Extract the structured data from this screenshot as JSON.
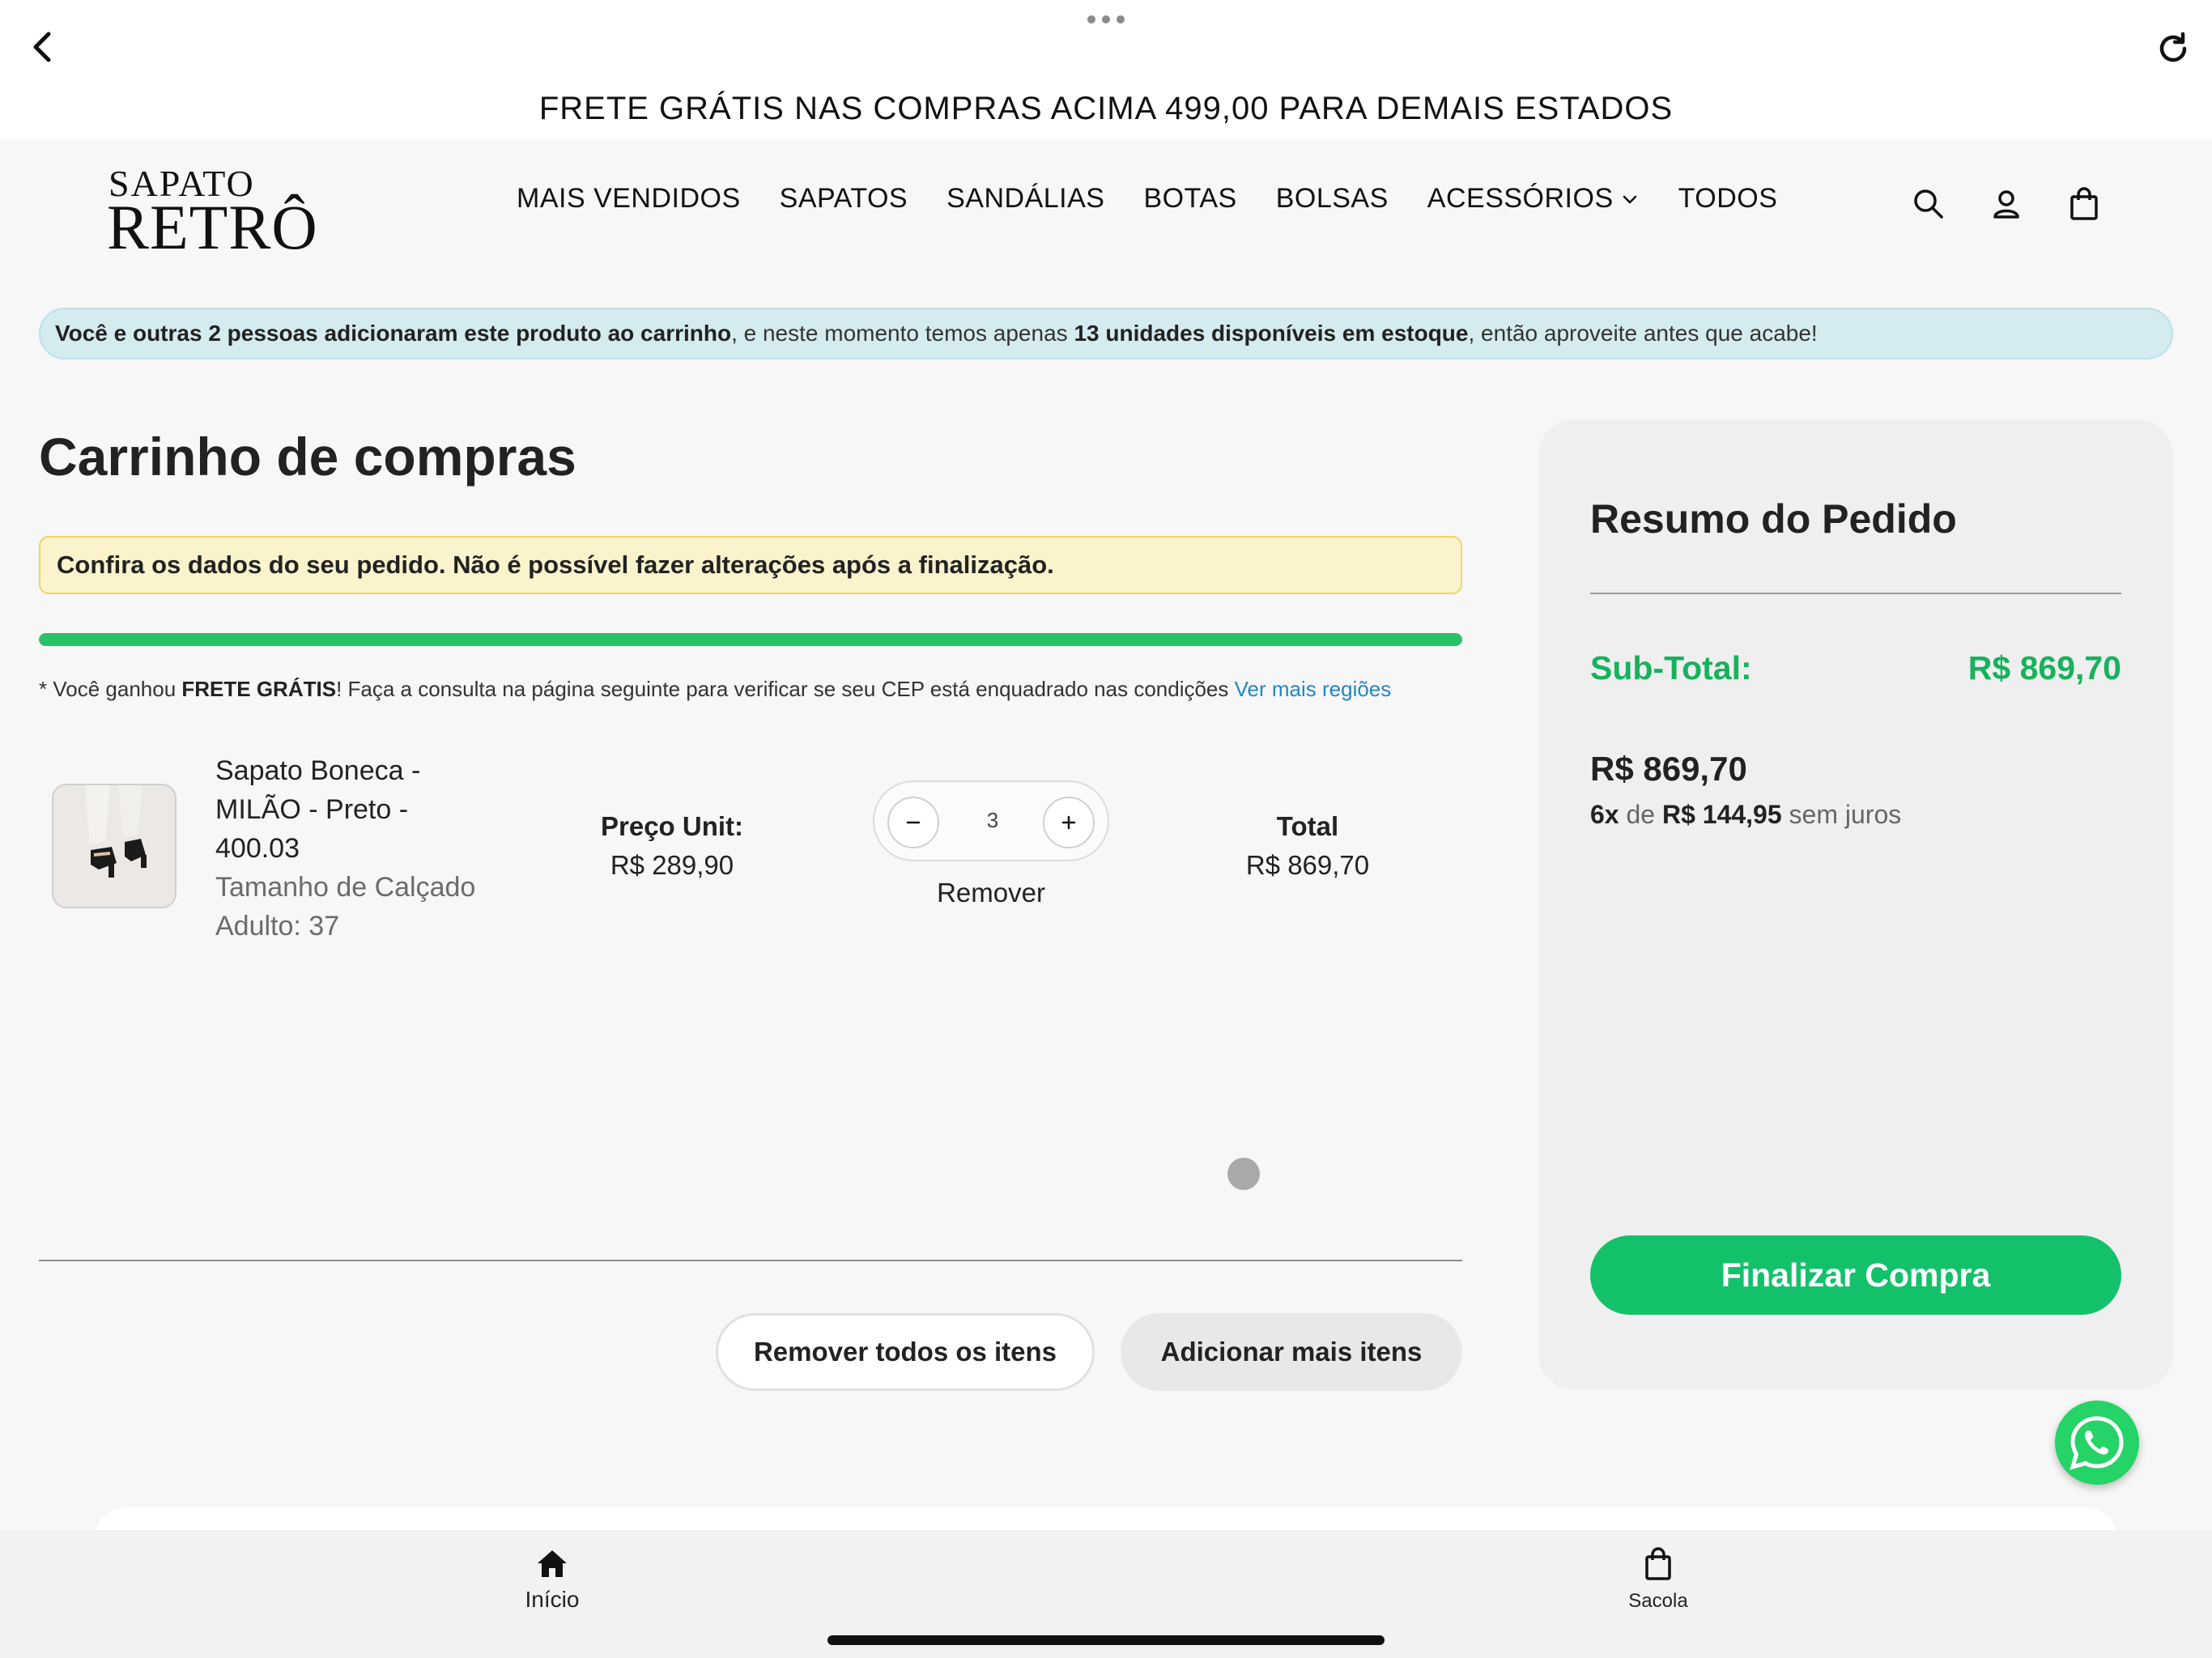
{
  "browser": {
    "back_icon": "chevron-left-icon",
    "reload_icon": "reload-icon",
    "more_icon": "ellipsis-icon"
  },
  "promo": {
    "text": "FRETE GRÁTIS NAS COMPRAS ACIMA 499,00 PARA DEMAIS ESTADOS"
  },
  "header": {
    "logo_line1": "SAPATO",
    "logo_line2": "RETRÔ",
    "nav": [
      {
        "label": "MAIS VENDIDOS"
      },
      {
        "label": "SAPATOS"
      },
      {
        "label": "SANDÁLIAS"
      },
      {
        "label": "BOTAS"
      },
      {
        "label": "BOLSAS"
      },
      {
        "label": "ACESSÓRIOS"
      },
      {
        "label": "TODOS"
      }
    ],
    "icons": [
      "search-icon",
      "user-icon",
      "shopping-bag-icon"
    ]
  },
  "proof_banner": {
    "bold1": "Você e outras 2 pessoas adicionaram este produto ao carrinho",
    "text1": ", e neste momento temos apenas ",
    "bold2": "13 unidades disponíveis em estoque",
    "text2": ", então aproveite antes que acabe!"
  },
  "cart": {
    "title": "Carrinho de compras",
    "warning": "Confira os dados do seu pedido. Não é possível fazer alterações após a finalização.",
    "progress_fraction": 1.0,
    "free_ship": {
      "prefix": "* Você ganhou ",
      "bold": "FRETE GRÁTIS",
      "suffix": "! Faça a consulta na página seguinte para verificar se seu CEP está enquadrado nas condições ",
      "link": "Ver mais regiões"
    },
    "item": {
      "name": "Sapato Boneca - MILÃO - Preto - 400.03",
      "variant": "Tamanho de Calçado Adulto: 37",
      "unit_price_label": "Preço Unit:",
      "unit_price": "R$ 289,90",
      "quantity": "3",
      "remove": "Remover",
      "total_label": "Total",
      "total": "R$ 869,70"
    },
    "remove_all": "Remover todos os itens",
    "add_more": "Adicionar mais itens"
  },
  "summary": {
    "title": "Resumo do Pedido",
    "subtotal_label": "Sub-Total:",
    "subtotal_value": "R$ 869,70",
    "total": "R$ 869,70",
    "installments_count": "6x",
    "installments_de": " de ",
    "installments_value": "R$ 144,95",
    "installments_suffix": " sem juros",
    "checkout": "Finalizar Compra"
  },
  "bottom_nav": {
    "home": "Início",
    "bag": "Sacola"
  },
  "colors": {
    "accent_green": "#14c16b",
    "link_blue": "#1e88c7",
    "warning_bg": "#fbf3cc",
    "proof_bg": "#d4ebf0"
  }
}
